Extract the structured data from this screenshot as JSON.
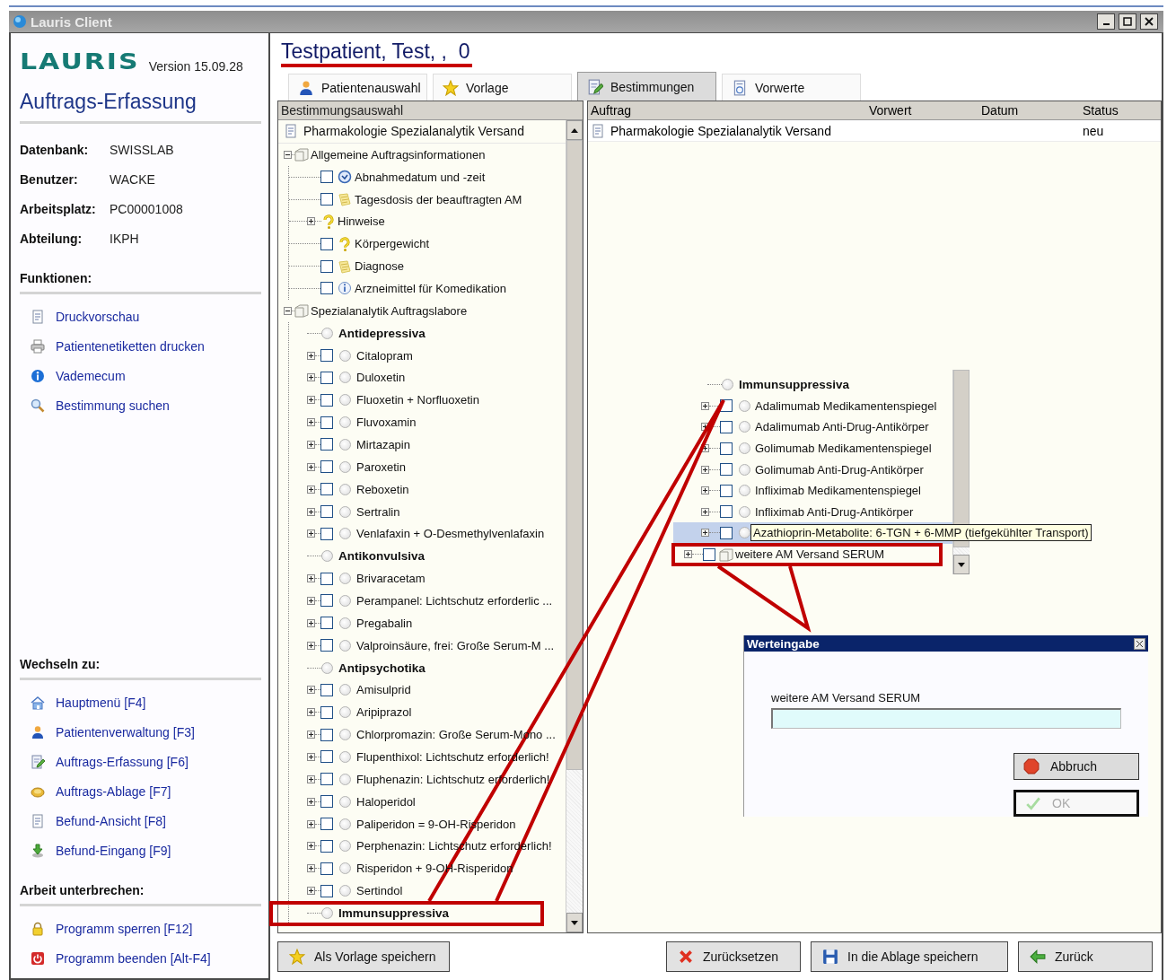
{
  "window": {
    "title": "Lauris Client"
  },
  "sidebar": {
    "logo": "LAURIS",
    "version": "Version 15.09.28",
    "module": "Auftrags-Erfassung",
    "info": [
      {
        "label": "Datenbank:",
        "value": "SWISSLAB"
      },
      {
        "label": "Benutzer:",
        "value": "WACKE"
      },
      {
        "label": "Arbeitsplatz:",
        "value": "PC00001008"
      },
      {
        "label": "Abteilung:",
        "value": "IKPH"
      }
    ],
    "sections": [
      {
        "title": "Funktionen:",
        "links": [
          "Druckvorschau",
          "Patientenetiketten drucken",
          "Vademecum",
          "Bestimmung suchen"
        ]
      },
      {
        "title": "Wechseln zu:",
        "links": [
          "Hauptmenü [F4]",
          "Patientenverwaltung [F3]",
          "Auftrags-Erfassung [F6]",
          "Auftrags-Ablage [F7]",
          "Befund-Ansicht [F8]",
          "Befund-Eingang [F9]"
        ]
      },
      {
        "title": "Arbeit unterbrechen:",
        "links": [
          "Programm sperren [F12]",
          "Programm beenden [Alt-F4]"
        ]
      }
    ]
  },
  "patient": "Testpatient, Test, ,  0",
  "tabs": [
    {
      "label": "Patientenauswahl",
      "selected": false
    },
    {
      "label": "Vorlage",
      "selected": false
    },
    {
      "label": "Bestimmungen",
      "selected": true
    },
    {
      "label": "Vorwerte",
      "selected": false
    }
  ],
  "tree": {
    "header": "Bestimmungsauswahl",
    "root": "Pharmakologie Spezialanalytik Versand",
    "nodes": [
      {
        "kind": "folder",
        "label": "Allgemeine Auftragsinformationen",
        "expanded": true,
        "children": [
          {
            "kind": "date",
            "label": "Abnahmedatum und -zeit",
            "checked": false
          },
          {
            "kind": "note",
            "label": "Tagesdosis der beauftragten AM",
            "checked": false
          },
          {
            "kind": "hint-group",
            "label": "Hinweise",
            "expanded": false
          },
          {
            "kind": "hint",
            "label": "Körpergewicht",
            "checked": false
          },
          {
            "kind": "note",
            "label": "Diagnose",
            "checked": false
          },
          {
            "kind": "info",
            "label": "Arzneimittel für Komedikation",
            "checked": false
          }
        ]
      },
      {
        "kind": "folder",
        "label": "Spezialanalytik Auftragslabore",
        "expanded": true,
        "children": [
          {
            "kind": "group",
            "label": "Antidepressiva",
            "chosen": false
          },
          {
            "kind": "analysis",
            "label": "Citalopram",
            "expanded": false,
            "checked": false,
            "chosen": false
          },
          {
            "kind": "analysis",
            "label": "Duloxetin",
            "expanded": false,
            "checked": false,
            "chosen": false
          },
          {
            "kind": "analysis",
            "label": "Fluoxetin + Norfluoxetin",
            "expanded": false,
            "checked": false,
            "chosen": false
          },
          {
            "kind": "analysis",
            "label": "Fluvoxamin",
            "expanded": false,
            "checked": false,
            "chosen": false
          },
          {
            "kind": "analysis",
            "label": "Mirtazapin",
            "expanded": false,
            "checked": false,
            "chosen": false
          },
          {
            "kind": "analysis",
            "label": "Paroxetin",
            "expanded": false,
            "checked": false,
            "chosen": false
          },
          {
            "kind": "analysis",
            "label": "Reboxetin",
            "expanded": false,
            "checked": false,
            "chosen": false
          },
          {
            "kind": "analysis",
            "label": "Sertralin",
            "expanded": false,
            "checked": false,
            "chosen": false
          },
          {
            "kind": "analysis",
            "label": "Venlafaxin + O-Desmethylvenlafaxin",
            "expanded": false,
            "checked": false,
            "chosen": false
          },
          {
            "kind": "group",
            "label": "Antikonvulsiva",
            "chosen": false
          },
          {
            "kind": "analysis",
            "label": "Brivaracetam",
            "expanded": false,
            "checked": false,
            "chosen": false
          },
          {
            "kind": "analysis",
            "label": "Perampanel: Lichtschutz erforderlic  ...",
            "expanded": false,
            "checked": false,
            "chosen": false
          },
          {
            "kind": "analysis",
            "label": "Pregabalin",
            "expanded": false,
            "checked": false,
            "chosen": false
          },
          {
            "kind": "analysis",
            "label": "Valproinsäure, frei: Große Serum-M  ...",
            "expanded": false,
            "checked": false,
            "chosen": false
          },
          {
            "kind": "group",
            "label": "Antipsychotika",
            "chosen": false
          },
          {
            "kind": "analysis",
            "label": "Amisulprid",
            "expanded": false,
            "checked": false,
            "chosen": false
          },
          {
            "kind": "analysis",
            "label": "Aripiprazol",
            "expanded": false,
            "checked": false,
            "chosen": false
          },
          {
            "kind": "analysis",
            "label": "Chlorpromazin: Große Serum-Mono  ...",
            "expanded": false,
            "checked": false,
            "chosen": false
          },
          {
            "kind": "analysis",
            "label": "Flupenthixol: Lichtschutz erforderlich!",
            "expanded": false,
            "checked": false,
            "chosen": false
          },
          {
            "kind": "analysis",
            "label": "Fluphenazin: Lichtschutz erforderlich!",
            "expanded": false,
            "checked": false,
            "chosen": false
          },
          {
            "kind": "analysis",
            "label": "Haloperidol",
            "expanded": false,
            "checked": false,
            "chosen": false
          },
          {
            "kind": "analysis",
            "label": "Paliperidon = 9-OH-Risperidon",
            "expanded": false,
            "checked": false,
            "chosen": false
          },
          {
            "kind": "analysis",
            "label": "Perphenazin: Lichtschutz erforderlich!",
            "expanded": false,
            "checked": false,
            "chosen": false
          },
          {
            "kind": "analysis",
            "label": "Risperidon + 9-OH-Risperidon",
            "expanded": false,
            "checked": false,
            "chosen": false
          },
          {
            "kind": "analysis",
            "label": "Sertindol",
            "expanded": false,
            "checked": false,
            "chosen": false
          },
          {
            "kind": "group",
            "label": "Immunsuppressiva",
            "chosen": false
          }
        ]
      }
    ]
  },
  "order": {
    "columns": [
      "Auftrag",
      "Vorwert",
      "Datum",
      "Status"
    ],
    "rows": [
      {
        "auftrag": "Pharmakologie Spezialanalytik Versand",
        "status": "neu"
      }
    ]
  },
  "inset": {
    "rows": [
      {
        "kind": "group",
        "label": "Immunsuppressiva",
        "chosen": false,
        "selected": false
      },
      {
        "kind": "analysis",
        "label": "Adalimumab Medikamentenspiegel",
        "expanded": false,
        "checked": false,
        "chosen": false,
        "selected": false
      },
      {
        "kind": "analysis",
        "label": "Adalimumab Anti-Drug-Antikörper",
        "expanded": false,
        "checked": false,
        "chosen": false,
        "selected": false
      },
      {
        "kind": "analysis",
        "label": "Golimumab Medikamentenspiegel",
        "expanded": false,
        "checked": false,
        "chosen": false,
        "selected": false
      },
      {
        "kind": "analysis",
        "label": "Golimumab Anti-Drug-Antikörper",
        "expanded": false,
        "checked": false,
        "chosen": false,
        "selected": false
      },
      {
        "kind": "analysis",
        "label": "Infliximab Medikamentenspiegel",
        "expanded": false,
        "checked": false,
        "chosen": false,
        "selected": false
      },
      {
        "kind": "analysis",
        "label": "Infliximab Anti-Drug-Antikörper",
        "expanded": false,
        "checked": false,
        "chosen": false,
        "selected": false
      },
      {
        "kind": "analysis",
        "tooltip": "Azathioprin-Metabolite: 6-TGN + 6-MMP (tiefgekühlter Transport)",
        "expanded": false,
        "checked": false,
        "chosen": false,
        "selected": true
      },
      {
        "kind": "folder",
        "label": "weitere AM Versand SERUM",
        "expanded": false,
        "checked": false,
        "selected": false
      }
    ]
  },
  "dialog": {
    "title": "Werteingabe",
    "label": "weitere AM Versand SERUM",
    "buttons": [
      {
        "label": "Abbruch",
        "disabled": false
      },
      {
        "label": "OK",
        "disabled": true
      }
    ]
  },
  "buttons": [
    "Als Vorlage speichern",
    "Zurücksetzen",
    "In die Ablage speichern",
    "Zurück"
  ]
}
